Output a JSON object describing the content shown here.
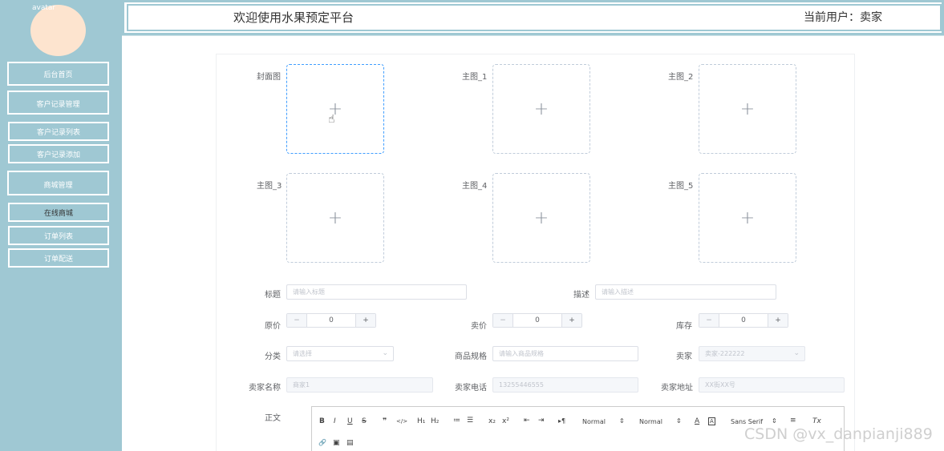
{
  "sidebar": {
    "avatar_alt": "avatar",
    "items": [
      {
        "label": "后台首页"
      },
      {
        "label": "客户记录管理"
      },
      {
        "label": "客户记录列表"
      },
      {
        "label": "客户记录添加"
      },
      {
        "label": "商城管理"
      },
      {
        "label": "在线商城"
      },
      {
        "label": "订单列表"
      },
      {
        "label": "订单配送"
      }
    ]
  },
  "header": {
    "title": "欢迎使用水果预定平台",
    "current_user": "当前用户：卖家"
  },
  "form": {
    "uploads": [
      {
        "label": "封面图"
      },
      {
        "label": "主图_1"
      },
      {
        "label": "主图_2"
      },
      {
        "label": "主图_3"
      },
      {
        "label": "主图_4"
      },
      {
        "label": "主图_5"
      }
    ],
    "title_label": "标题",
    "title_placeholder": "请输入标题",
    "desc_label": "描述",
    "desc_placeholder": "请输入描述",
    "orig_price_label": "原价",
    "orig_price_value": "0",
    "price_label": "卖价",
    "price_value": "0",
    "stock_label": "库存",
    "stock_value": "0",
    "category_label": "分类",
    "category_placeholder": "请选择",
    "spec_label": "商品规格",
    "spec_placeholder": "请输入商品规格",
    "seller_label": "卖家",
    "seller_value": "卖家-222222",
    "seller_name_label": "卖家名称",
    "seller_name_value": "商家1",
    "seller_phone_label": "卖家电话",
    "seller_phone_value": "13255446555",
    "seller_addr_label": "卖家地址",
    "seller_addr_value": "XX街XX号",
    "content_label": "正文"
  },
  "editor": {
    "bold": "B",
    "italic": "I",
    "underline": "U",
    "strike": "S",
    "quote": "❞",
    "code": "</>",
    "h1": "H₁",
    "h2": "H₂",
    "ol": "≔",
    "ul": "☰",
    "sub": "x₂",
    "sup": "x²",
    "outdent": "⇤",
    "indent": "⇥",
    "direction": "▸¶",
    "size1": "Normal",
    "size2": "Normal",
    "color": "A",
    "background": "A",
    "font": "Sans Serif",
    "align": "≡",
    "clean": "Tx",
    "link": "🔗",
    "image": "▣",
    "video": "▤"
  },
  "watermark": "CSDN @vx_danpianji889"
}
